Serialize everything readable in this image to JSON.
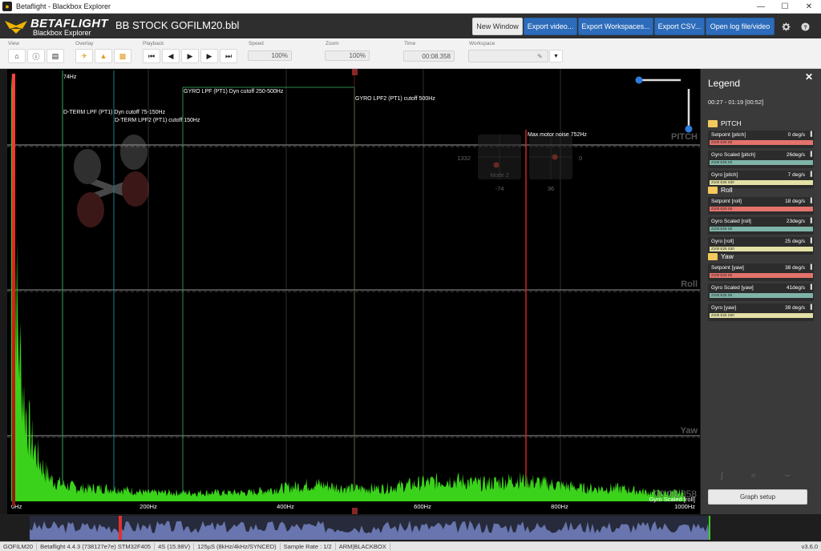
{
  "window": {
    "title": "Betaflight - Blackbox Explorer"
  },
  "header": {
    "brand": "BETAFLIGHT",
    "brand_sub": "Blackbox Explorer",
    "log_file": "BB STOCK GOFILM20.bbl",
    "buttons": {
      "new_window": "New Window",
      "export_video": "Export video...",
      "export_workspaces": "Export Workspaces...",
      "export_csv": "Export CSV...",
      "open_log": "Open log file/video"
    },
    "icons": [
      "gear-icon",
      "help-icon"
    ]
  },
  "toolbar": {
    "view_label": "View",
    "overlay_label": "Overlay",
    "playback_label": "Playback",
    "speed_label": "Speed",
    "speed_value": "100%",
    "zoom_label": "Zoom",
    "zoom_value": "100%",
    "time_label": "Time",
    "time_value": "00:08.358",
    "workspace_label": "Workspace"
  },
  "graph": {
    "x_ticks": [
      "0Hz",
      "200Hz",
      "400Hz",
      "600Hz",
      "800Hz",
      "1000Hz"
    ],
    "axis_labels": [
      "PITCH",
      "Roll",
      "Yaw"
    ],
    "filter_markers": {
      "m74": "74Hz",
      "dterm_lpf": "D-TERM LPF (PT1) Dyn cutoff 75-150Hz",
      "dterm_lpf2": "D-TERM LPF2 (PT1) cutoff 150Hz",
      "gyro_lpf": "GYRO LPF (PT1) Dyn cutoff 250-500Hz",
      "gyro_lpf2": "GYRO LPF2 (PT1) cutoff 500Hz",
      "motor_noise": "Max motor noise 752Hz"
    },
    "stick_left": "1332",
    "stick_right": "0",
    "stick_bottom_left": "-74",
    "stick_bottom_right": "36",
    "mode_label": "Mode 2",
    "trace_label": "Gyro Scaled [roll]",
    "corner_time": "00:08.358",
    "colors": {
      "spectrum": "#3ad21a",
      "motor_noise_line": "#c0231f",
      "filter_line": "#2e8b4d"
    }
  },
  "chart_data": {
    "type": "area",
    "title": "",
    "xlabel": "",
    "ylabel": "",
    "xlim": [
      0,
      1000
    ],
    "x_unit": "Hz",
    "series": [
      {
        "name": "Gyro Scaled [roll]",
        "x": [
          0,
          5,
          10,
          20,
          30,
          40,
          50,
          60,
          74,
          100,
          150,
          200,
          250,
          300,
          350,
          400,
          450,
          500,
          550,
          600,
          650,
          700,
          750,
          800,
          850,
          900,
          950,
          1000
        ],
        "values": [
          100,
          60,
          38,
          22,
          14,
          10,
          7,
          5,
          4,
          3,
          3,
          2,
          2,
          2,
          2,
          3,
          4,
          3,
          3,
          4,
          5,
          4,
          5,
          4,
          3,
          3,
          2,
          2
        ]
      }
    ]
  },
  "legend": {
    "title": "Legend",
    "time_range": "00:27 - 01:19 [00:52]",
    "groups": [
      {
        "name": "PITCH",
        "items": [
          {
            "name": "Setpoint [pitch]",
            "value": "0 deg/s",
            "bar": "Z100 E20 S0",
            "color": "#e4736c"
          },
          {
            "name": "Gyro Scaled [pitch]",
            "value": "26deg/s",
            "bar": "Z100 E25 S0",
            "color": "#7fb4a8"
          },
          {
            "name": "Gyro [pitch]",
            "value": "7 deg/s",
            "bar": "Z100 E25 S30",
            "color": "#e3e1a6"
          }
        ]
      },
      {
        "name": "Roll",
        "items": [
          {
            "name": "Setpoint [roll]",
            "value": "18 deg/s",
            "bar": "Z100 E20 S0",
            "color": "#e4736c"
          },
          {
            "name": "Gyro Scaled [roll]",
            "value": "23deg/s",
            "bar": "Z100 E25 S0",
            "color": "#7fb4a8"
          },
          {
            "name": "Gyro [roll]",
            "value": "25 deg/s",
            "bar": "Z100 E25 S30",
            "color": "#e3e1a6"
          }
        ]
      },
      {
        "name": "Yaw",
        "items": [
          {
            "name": "Setpoint [yaw]",
            "value": "38 deg/s",
            "bar": "Z100 E20 S0",
            "color": "#e4736c"
          },
          {
            "name": "Gyro Scaled [yaw]",
            "value": "41deg/s",
            "bar": "Z100 E25 S0",
            "color": "#7fb4a8"
          },
          {
            "name": "Gyro [yaw]",
            "value": "39 deg/s",
            "bar": "Z100 E25 S30",
            "color": "#e3e1a6"
          }
        ]
      }
    ],
    "graph_setup": "Graph setup"
  },
  "statusbar": {
    "segments": [
      "GOFILM20",
      "Betaflight 4.4.3 (738127e7e) STM32F405",
      "4S (15.98V)",
      "125µS (8kHz/4kHz/SYNCED)",
      "Sample Rate : 1/2",
      "ARM|BLACKBOX"
    ],
    "version": "v3.6.0"
  }
}
